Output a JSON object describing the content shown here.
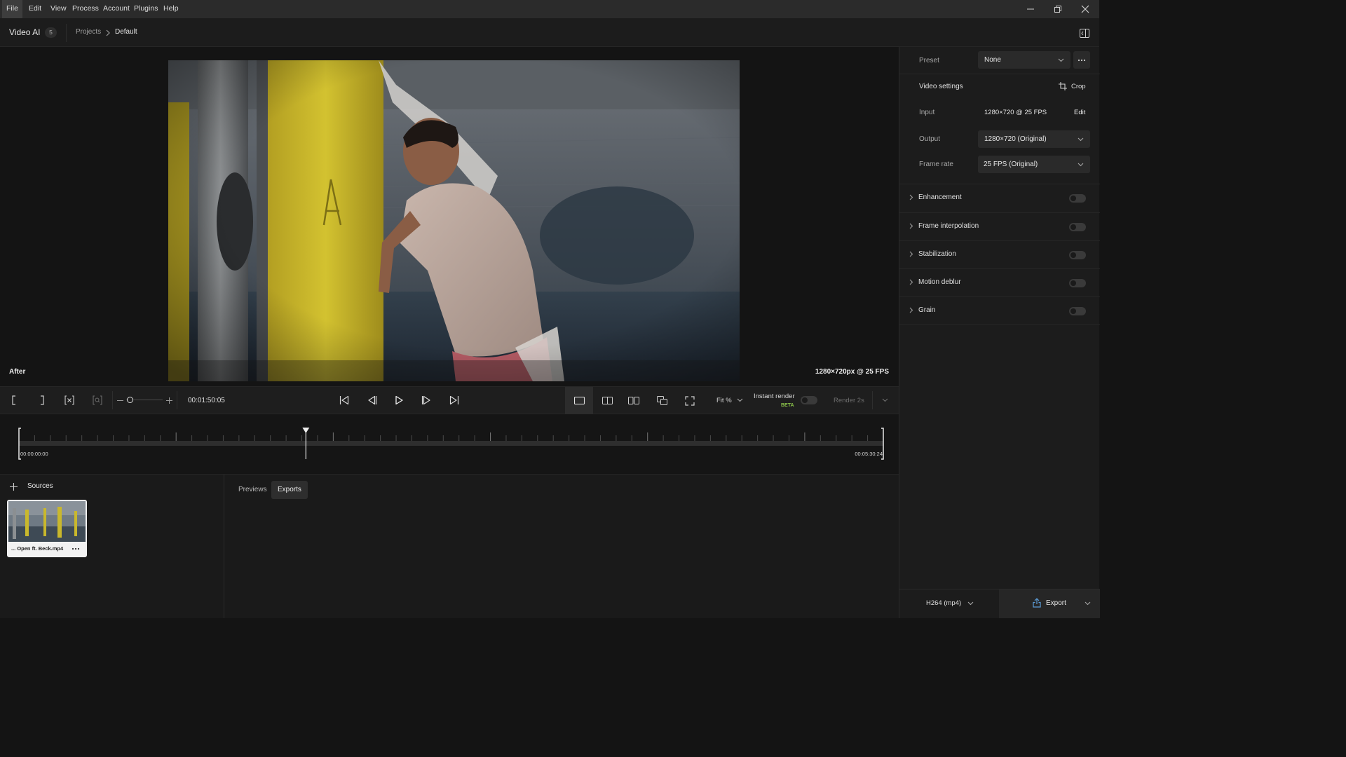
{
  "menu": {
    "items": [
      "File",
      "Edit",
      "View",
      "Process",
      "Account",
      "Plugins",
      "Help"
    ],
    "active": "File"
  },
  "header": {
    "app_title": "Video AI",
    "badge": "5",
    "breadcrumb": [
      "Projects",
      "Default"
    ]
  },
  "preview": {
    "view_label": "After",
    "resolution_info": "1280×720px @ 25 FPS"
  },
  "controls": {
    "timecode": "00:01:50:05",
    "zoom_label": "Fit %",
    "instant_render_label": "Instant render",
    "beta_badge": "BETA",
    "render_label": "Render 2s",
    "accent": "#8bc34a"
  },
  "timeline": {
    "start": "00:00:00:00",
    "end": "00:05:30:24",
    "playhead_fraction": 0.332
  },
  "sources": {
    "title": "Sources",
    "items": [
      {
        "filename": "... Open ft. Beck.mp4"
      }
    ]
  },
  "output_tabs": [
    "Previews",
    "Exports"
  ],
  "active_output_tab": "Exports",
  "panel": {
    "preset_label": "Preset",
    "preset_value": "None",
    "video_settings_label": "Video settings",
    "crop_label": "Crop",
    "input_label": "Input",
    "input_value": "1280×720 @ 25 FPS",
    "input_edit": "Edit",
    "output_label": "Output",
    "output_value": "1280×720 (Original)",
    "frame_rate_label": "Frame rate",
    "frame_rate_value": "25 FPS (Original)",
    "sections": [
      {
        "label": "Enhancement",
        "enabled": false
      },
      {
        "label": "Frame interpolation",
        "enabled": false
      },
      {
        "label": "Stabilization",
        "enabled": false
      },
      {
        "label": "Motion deblur",
        "enabled": false
      },
      {
        "label": "Grain",
        "enabled": false
      }
    ]
  },
  "footer": {
    "format": "H264 (mp4)",
    "export_label": "Export"
  }
}
